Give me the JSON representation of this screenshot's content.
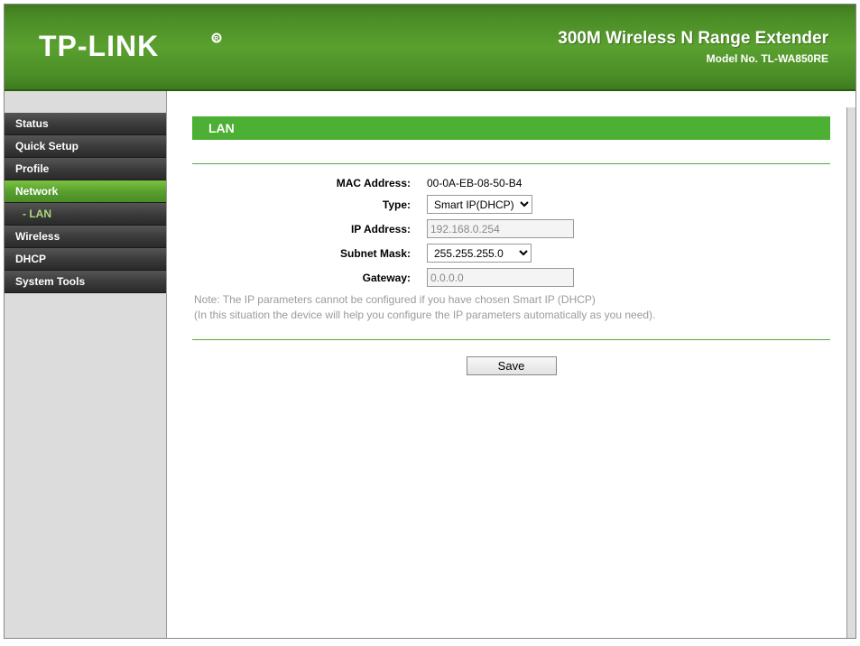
{
  "header": {
    "brand": "TP-LINK",
    "product_title": "300M Wireless N Range Extender",
    "model_no": "Model No. TL-WA850RE"
  },
  "sidebar": {
    "items": [
      {
        "label": "Status",
        "active": false
      },
      {
        "label": "Quick Setup",
        "active": false
      },
      {
        "label": "Profile",
        "active": false
      },
      {
        "label": "Network",
        "active": true
      },
      {
        "label": "- LAN",
        "sub": true
      },
      {
        "label": "Wireless",
        "active": false
      },
      {
        "label": "DHCP",
        "active": false
      },
      {
        "label": "System Tools",
        "active": false
      }
    ]
  },
  "panel": {
    "title": "LAN",
    "mac_label": "MAC Address:",
    "mac_value": "00-0A-EB-08-50-B4",
    "type_label": "Type:",
    "type_value": "Smart IP(DHCP)",
    "ip_label": "IP Address:",
    "ip_value": "192.168.0.254",
    "mask_label": "Subnet Mask:",
    "mask_value": "255.255.255.0",
    "gateway_label": "Gateway:",
    "gateway_value": "0.0.0.0",
    "note_line1": "Note: The IP parameters cannot be configured if you have chosen Smart IP (DHCP)",
    "note_line2": "(In this situation the device will help you configure the IP parameters automatically as you need).",
    "save_label": "Save"
  }
}
